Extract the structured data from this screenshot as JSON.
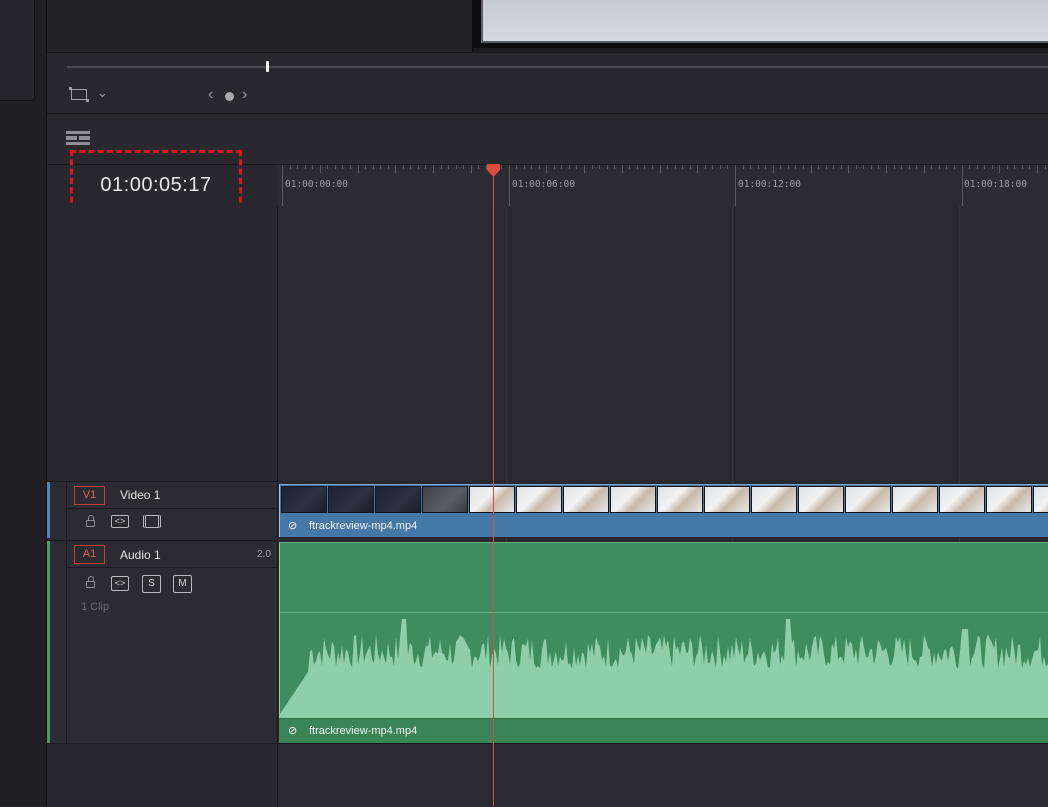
{
  "timeline": {
    "timecode": "01:00:05:17",
    "ruler_labels": [
      "01:00:00:00",
      "01:00:06:00",
      "01:00:12:00",
      "01:00:18:00"
    ]
  },
  "tracks": [
    {
      "tag": "V1",
      "name": "Video 1",
      "clip_name": "ftrackreview-mp4.mp4"
    },
    {
      "tag": "A1",
      "name": "Audio 1",
      "channels": "2.0",
      "solo_label": "S",
      "mute_label": "M",
      "clip_count": "1 Clip",
      "clip_name": "ftrackreview-mp4.mp4"
    }
  ],
  "viewer": {
    "nav_prev": "‹",
    "nav_next": "›",
    "dropdown_chevron": "⌄"
  },
  "colors": {
    "playhead": "#e04a3e",
    "video_clip": "#4578a6",
    "audio_clip": "#3f8c5e",
    "highlight_box": "#e2141b"
  }
}
